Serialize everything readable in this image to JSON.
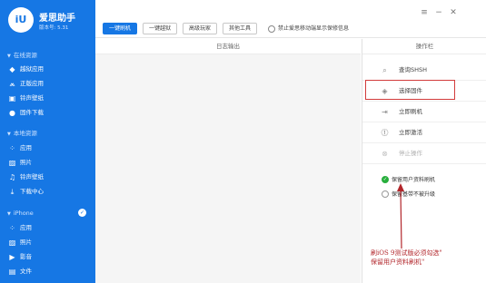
{
  "app": {
    "logo_text": "iU",
    "name": "爱思助手",
    "version": "版本号: 5.31"
  },
  "sidebar": {
    "sections": [
      {
        "title": "在线资源",
        "items": [
          {
            "label": "越狱应用",
            "icon": "app-store-icon"
          },
          {
            "label": "正版应用",
            "icon": "apps-icon"
          },
          {
            "label": "铃声壁纸",
            "icon": "ringtone-icon"
          },
          {
            "label": "固件下载",
            "icon": "firmware-icon"
          }
        ]
      },
      {
        "title": "本地资源",
        "items": [
          {
            "label": "应用",
            "icon": "grid-icon"
          },
          {
            "label": "照片",
            "icon": "photo-icon"
          },
          {
            "label": "铃声壁纸",
            "icon": "music-icon"
          },
          {
            "label": "下载中心",
            "icon": "download-icon"
          }
        ]
      },
      {
        "title": "iPhone",
        "items": [
          {
            "label": "应用",
            "icon": "grid-icon"
          },
          {
            "label": "照片",
            "icon": "photo-icon"
          },
          {
            "label": "影音",
            "icon": "media-icon"
          },
          {
            "label": "文件",
            "icon": "file-icon"
          }
        ]
      }
    ]
  },
  "toolbar": {
    "buttons": [
      "一键刷机",
      "一键越狱",
      "高级玩家",
      "其他工具"
    ],
    "active_index": 0,
    "radio_label": "禁止爱思移动端显示保修信息"
  },
  "window": {
    "menu_icon": "≡",
    "minimize_icon": "−",
    "close_icon": "✕"
  },
  "log": {
    "header": "日志输出"
  },
  "operations": {
    "header": "操作栏",
    "items": [
      {
        "label": "查询SHSH",
        "icon": "search-icon",
        "enabled": true
      },
      {
        "label": "选择固件",
        "icon": "box-icon",
        "enabled": true
      },
      {
        "label": "立即刷机",
        "icon": "flash-icon",
        "enabled": true
      },
      {
        "label": "立即激活",
        "icon": "activate-icon",
        "enabled": true
      },
      {
        "label": "停止操作",
        "icon": "stop-icon",
        "enabled": false
      }
    ],
    "options": [
      {
        "label": "保留用户资料刷机",
        "checked": true
      },
      {
        "label": "保留基带不被升级",
        "checked": false
      }
    ]
  },
  "annotation": {
    "line1": "刷iOS 9测试版必须勾选\"",
    "line2": "保留用户资料刷机\""
  },
  "colors": {
    "sidebar": "#1677e4",
    "highlight": "#d23c3c",
    "annotation": "#b2262b",
    "check": "#27ae3c"
  }
}
